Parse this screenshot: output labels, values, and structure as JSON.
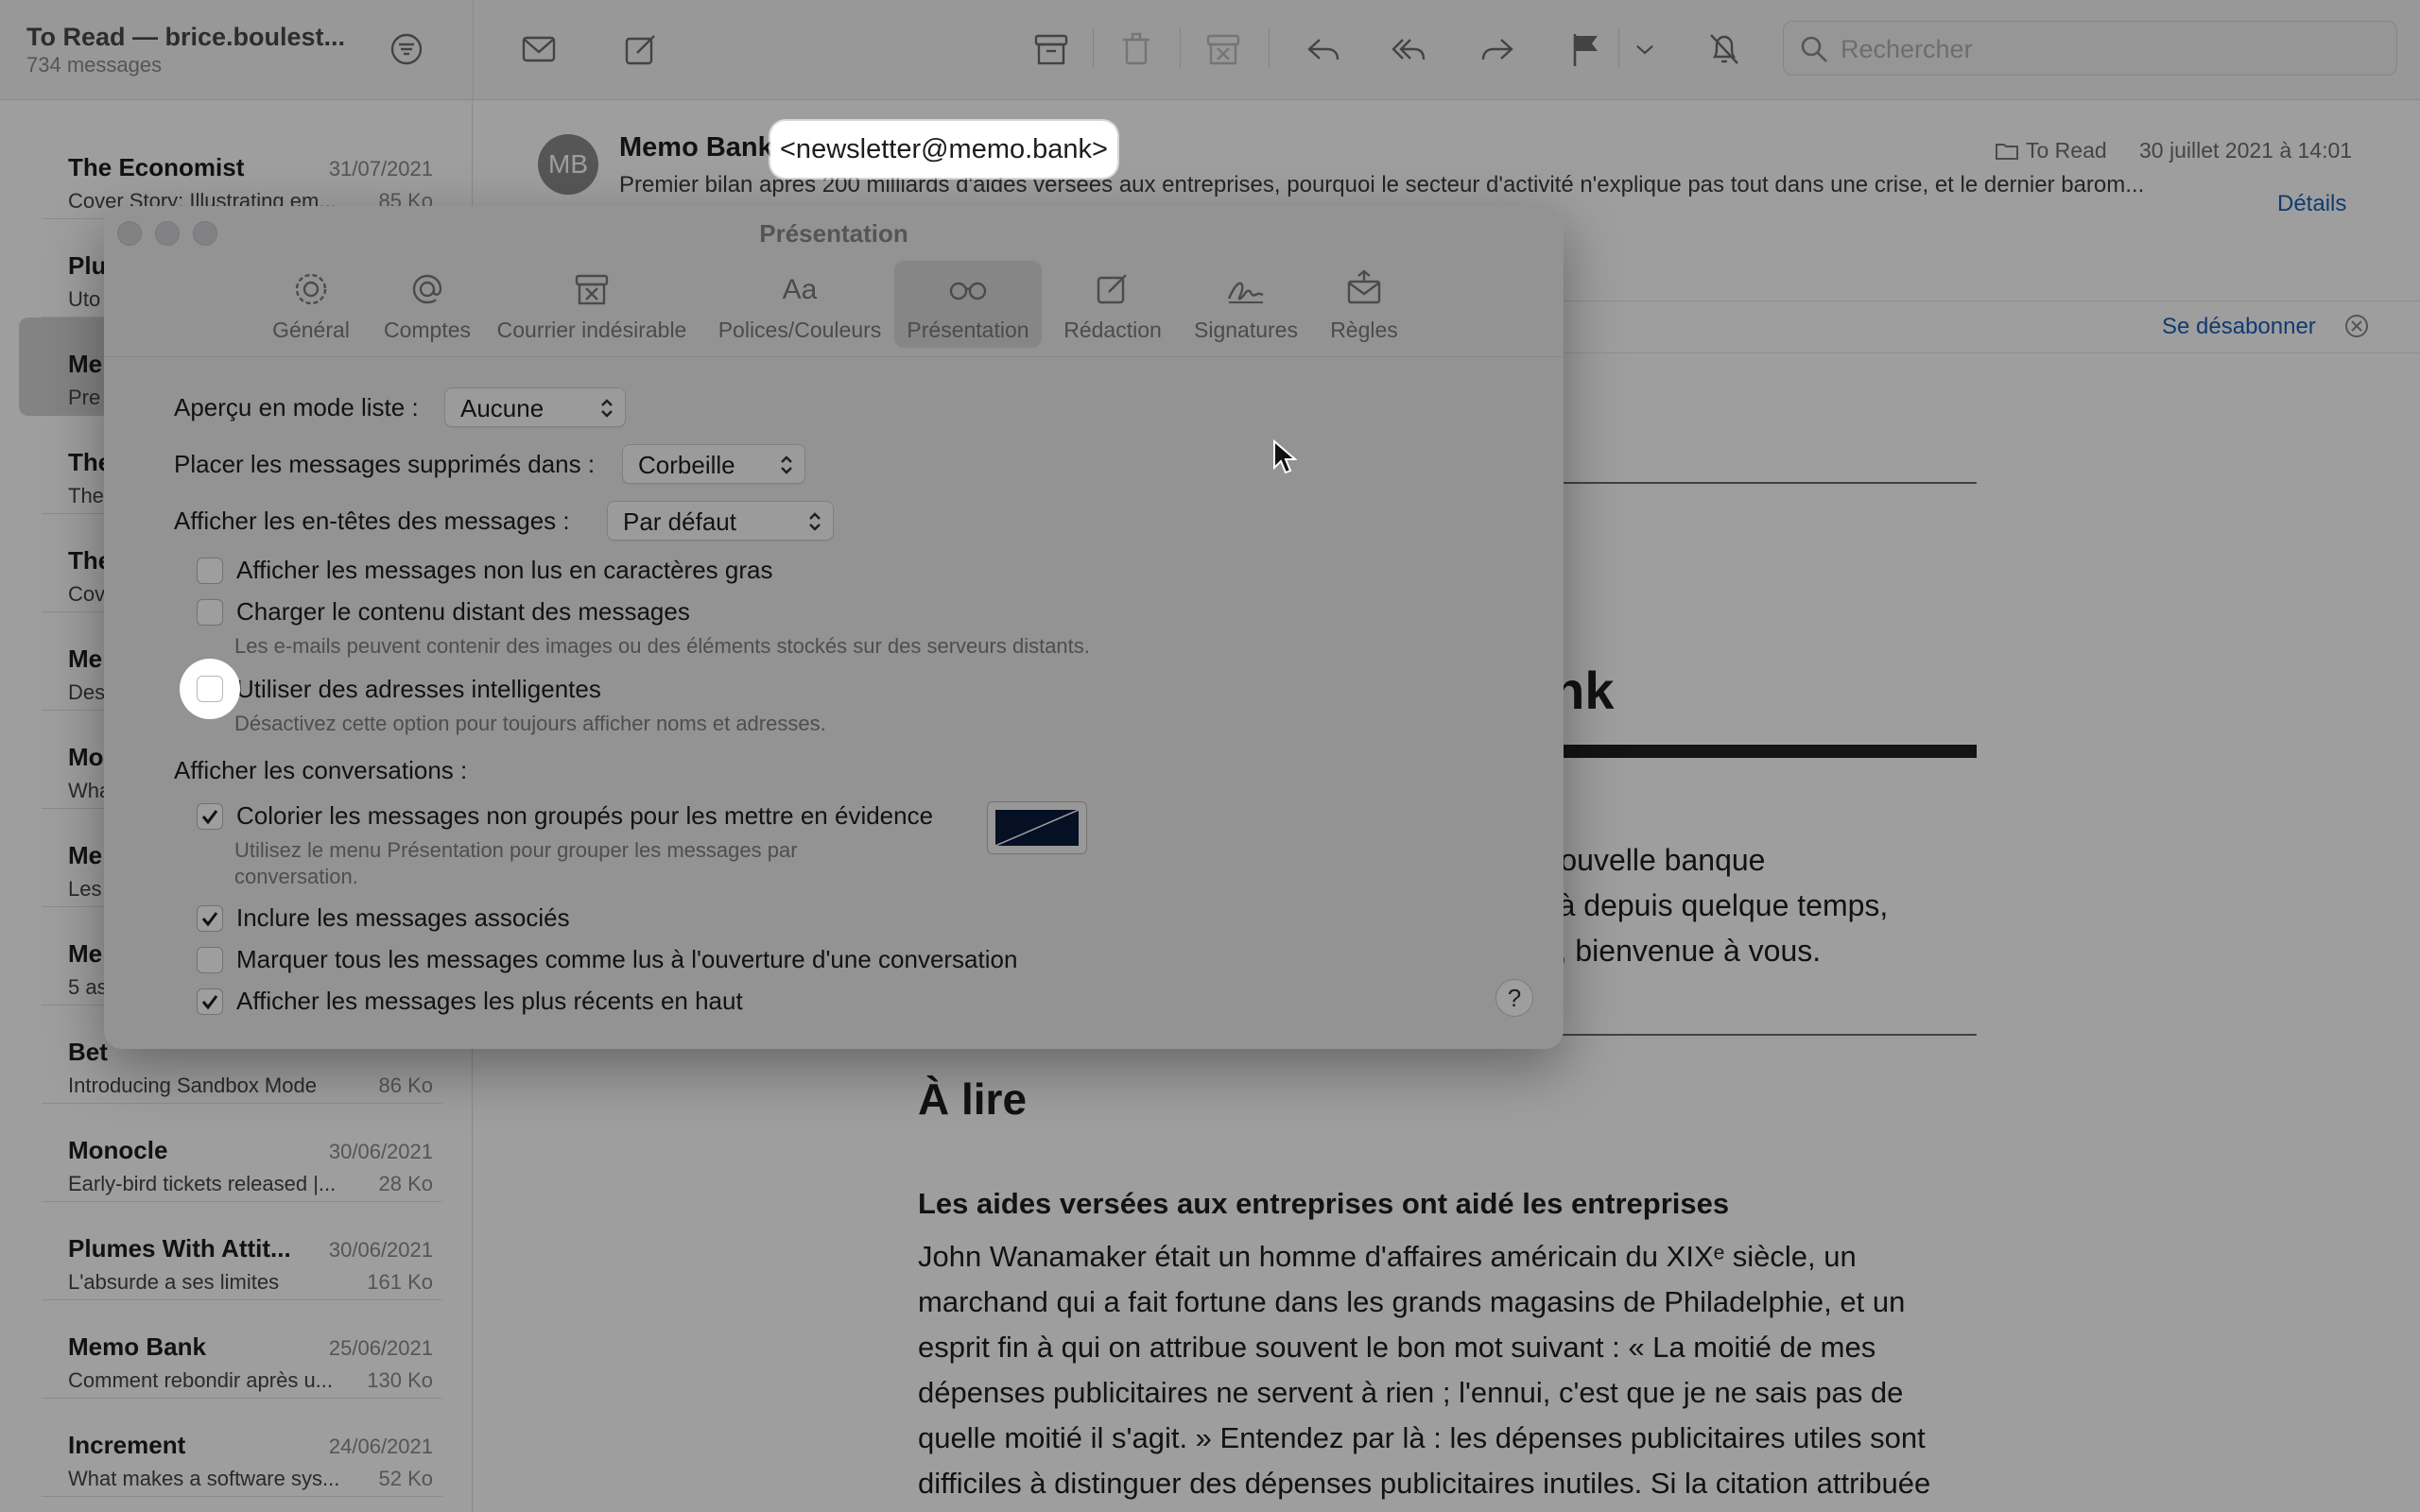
{
  "toolbar": {
    "mailbox_title": "To Read — brice.boulest...",
    "message_count": "734 messages",
    "search_placeholder": "Rechercher"
  },
  "message_list": [
    {
      "sender": "The Economist",
      "date": "31/07/2021",
      "preview": "Cover Story: Illustrating em...",
      "size": "85 Ko",
      "selected": false
    },
    {
      "sender": "Plu",
      "date": "",
      "preview": "Uto",
      "size": "",
      "selected": false
    },
    {
      "sender": "Me",
      "date": "",
      "preview": "Pre",
      "size": "",
      "selected": true
    },
    {
      "sender": "The",
      "date": "",
      "preview": "The",
      "size": "",
      "selected": false
    },
    {
      "sender": "The",
      "date": "",
      "preview": "Cov",
      "size": "",
      "selected": false
    },
    {
      "sender": "Me",
      "date": "",
      "preview": "Des",
      "size": "",
      "selected": false
    },
    {
      "sender": "Mo",
      "date": "",
      "preview": "Wha",
      "size": "",
      "selected": false
    },
    {
      "sender": "Me",
      "date": "",
      "preview": "Les",
      "size": "",
      "selected": false
    },
    {
      "sender": "Me",
      "date": "",
      "preview": "5 as",
      "size": "",
      "selected": false
    },
    {
      "sender": "Bet",
      "date": "",
      "preview": "Introducing Sandbox Mode",
      "size": "86 Ko",
      "selected": false
    },
    {
      "sender": "Monocle",
      "date": "30/06/2021",
      "preview": "Early-bird tickets released |...",
      "size": "28 Ko",
      "selected": false
    },
    {
      "sender": "Plumes With Attit...",
      "date": "30/06/2021",
      "preview": "L'absurde a ses limites",
      "size": "161 Ko",
      "selected": false
    },
    {
      "sender": "Memo Bank",
      "date": "25/06/2021",
      "preview": "Comment rebondir après u...",
      "size": "130 Ko",
      "selected": false
    },
    {
      "sender": "Increment",
      "date": "24/06/2021",
      "preview": "What makes a software sys...",
      "size": "52 Ko",
      "selected": false
    }
  ],
  "email": {
    "avatar_initials": "MB",
    "sender_name": "Memo Bank",
    "sender_address": "<newsletter@memo.bank>",
    "folder": "To Read",
    "date": "30 juillet 2021 à 14:01",
    "subject": "Premier bilan après 200 milliards d'aides versées aux entreprises, pourquoi le secteur d'activité n'explique pas tout dans une crise, et le dernier barom...",
    "details_label": "Détails",
    "unsubscribe_label": "Se désabonner",
    "body": {
      "bank_title_fragment": "ank",
      "welcome_lines": [
        ", la nouvelle banque",
        "z déjà depuis quelque temps,",
        " juste, bienvenue à vous."
      ],
      "section_title": "À lire",
      "article_title": "Les aides versées aux entreprises ont aidé les entreprises",
      "article_text": "John Wanamaker était un homme d'affaires américain du XIXᵉ siècle, un marchand qui a fait fortune dans les grands magasins de Philadelphie, et un esprit fin à qui on attribue souvent le bon mot suivant : « La moitié de mes dépenses publicitaires ne servent à rien ; l'ennui, c'est que je ne sais pas de quelle moitié il s'agit. » Entendez par là : les dépenses publicitaires utiles sont difficiles à distinguer des dépenses publicitaires inutiles. Si la citation attribuée"
    }
  },
  "preferences": {
    "window_title": "Présentation",
    "tabs": [
      {
        "label": "Général",
        "icon": "gear-icon",
        "active": false
      },
      {
        "label": "Comptes",
        "icon": "at-icon",
        "active": false
      },
      {
        "label": "Courrier indésirable",
        "icon": "junk-icon",
        "active": false
      },
      {
        "label": "Polices/Couleurs",
        "icon": "font-icon",
        "active": false
      },
      {
        "label": "Présentation",
        "icon": "glasses-icon",
        "active": true
      },
      {
        "label": "Rédaction",
        "icon": "compose-icon",
        "active": false
      },
      {
        "label": "Signatures",
        "icon": "signature-icon",
        "active": false
      },
      {
        "label": "Règles",
        "icon": "rules-icon",
        "active": false
      }
    ],
    "list_preview_label": "Aperçu en mode liste :",
    "list_preview_value": "Aucune",
    "deleted_label": "Placer les messages supprimés dans :",
    "deleted_value": "Corbeille",
    "headers_label": "Afficher les en-têtes des messages :",
    "headers_value": "Par défaut",
    "options": {
      "bold_unread": {
        "label": "Afficher les messages non lus en caractères gras",
        "checked": false
      },
      "remote_content": {
        "label": "Charger le contenu distant des messages",
        "checked": false,
        "hint": "Les e-mails peuvent contenir des images ou des éléments stockés sur des serveurs distants."
      },
      "smart_addresses": {
        "label": "Utiliser des adresses intelligentes",
        "checked": false,
        "hint": "Désactivez cette option pour toujours afficher noms et adresses."
      }
    },
    "conversations_label": "Afficher les conversations :",
    "conversation_options": {
      "color_ungrouped": {
        "label": "Colorier les messages non groupés pour les mettre en évidence",
        "checked": true,
        "hint_line1": "Utilisez le menu Présentation pour grouper les messages par",
        "hint_line2": "conversation."
      },
      "include_related": {
        "label": "Inclure les messages associés",
        "checked": true
      },
      "mark_all_read": {
        "label": "Marquer tous les messages comme lus à l'ouverture d'une conversation",
        "checked": false
      },
      "recent_on_top": {
        "label": "Afficher les messages les plus récents en haut",
        "checked": true
      }
    },
    "highlight_color": "#0b1a3a",
    "help_label": "?"
  }
}
